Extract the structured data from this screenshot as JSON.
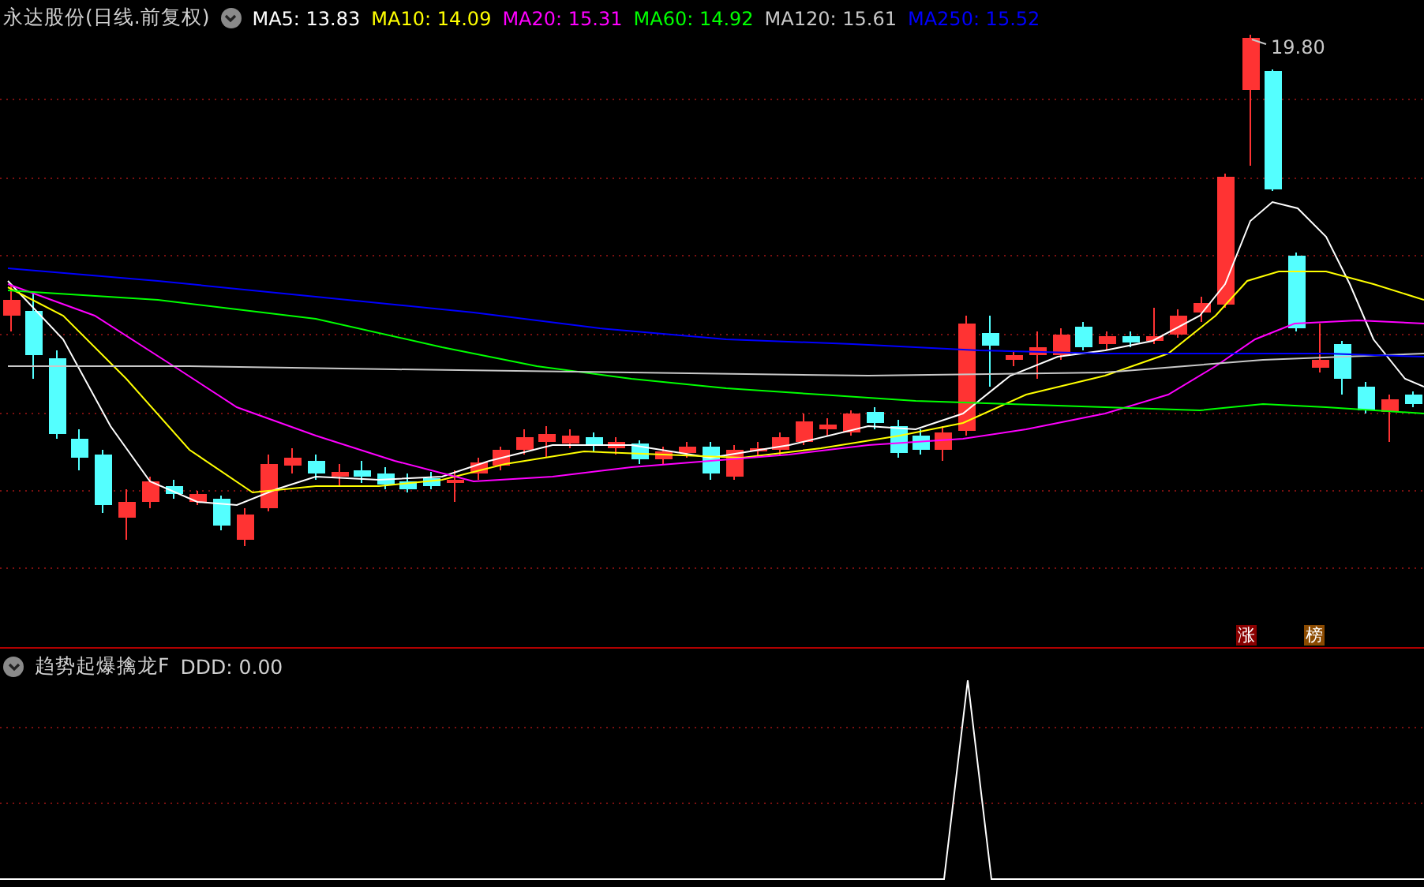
{
  "main_chart": {
    "title": "永达股份(日线.前复权)",
    "ma_legend": [
      {
        "label": "MA5: 13.83",
        "color": "#ffffff"
      },
      {
        "label": "MA10: 14.09",
        "color": "#ffff00"
      },
      {
        "label": "MA20: 15.31",
        "color": "#ff00ff"
      },
      {
        "label": "MA60: 14.92",
        "color": "#00ff00"
      },
      {
        "label": "MA120: 15.61",
        "color": "#c8c8c8"
      },
      {
        "label": "MA250: 15.52",
        "color": "#0000ff"
      }
    ],
    "high_label": "19.80",
    "markers": [
      {
        "text": "涨",
        "color": "#8b0000"
      },
      {
        "text": "榜",
        "color": "#8b4a00"
      }
    ]
  },
  "indicator_panel": {
    "title": "趋势起爆擒龙F",
    "value": "DDD: 0.00"
  }
}
